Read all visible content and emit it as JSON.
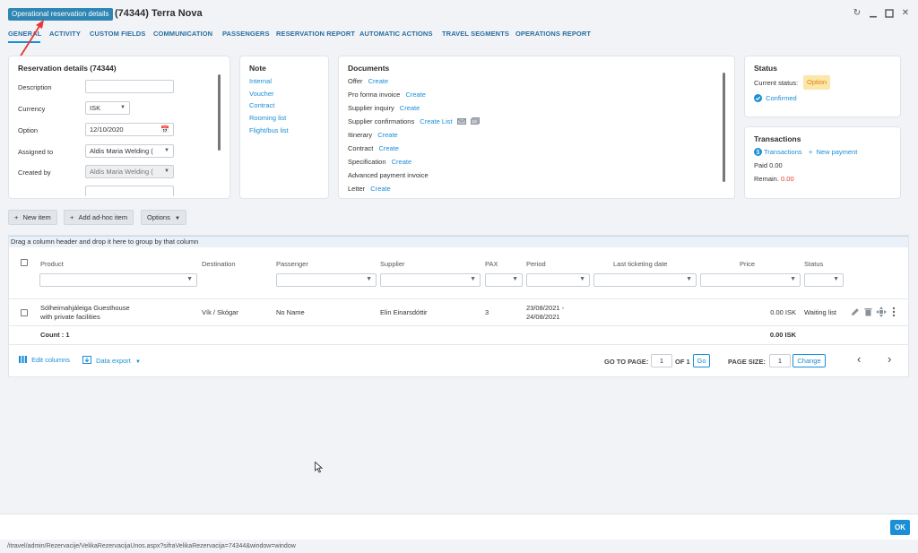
{
  "header": {
    "badge": "Operational reservation details",
    "title": "(74344) Terra Nova"
  },
  "tabs": [
    "GENERAL",
    "ACTIVITY",
    "CUSTOM FIELDS",
    "COMMUNICATION",
    "PASSENGERS",
    "RESERVATION REPORT",
    "AUTOMATIC ACTIONS",
    "TRAVEL SEGMENTS",
    "OPERATIONS REPORT"
  ],
  "reservation": {
    "heading": "Reservation details (74344)",
    "description_label": "Description",
    "description_value": "",
    "currency_label": "Currency",
    "currency_value": "ISK",
    "option_label": "Option",
    "option_value": "12/10/2020",
    "assigned_label": "Assigned to",
    "assigned_value": "Aldis Maria  Welding (",
    "created_label": "Created by",
    "created_value": "Aldis Maria  Welding ("
  },
  "note": {
    "heading": "Note",
    "items": [
      "Internal",
      "Voucher",
      "Contract",
      "Rooming list",
      "Flight/bus list"
    ]
  },
  "documents": {
    "heading": "Documents",
    "rows": [
      {
        "label": "Offer",
        "action": "Create"
      },
      {
        "label": "Pro forma invoice",
        "action": "Create"
      },
      {
        "label": "Supplier inquiry",
        "action": "Create"
      },
      {
        "label": "Supplier confirmations",
        "action": "Create List"
      },
      {
        "label": "Itinerary",
        "action": "Create"
      },
      {
        "label": "Contract",
        "action": "Create"
      },
      {
        "label": "Specification",
        "action": "Create"
      },
      {
        "label": "Advanced payment invoice",
        "action": ""
      },
      {
        "label": "Letter",
        "action": "Create"
      }
    ]
  },
  "status": {
    "heading": "Status",
    "current_label": "Current status:",
    "current_value": "Option",
    "confirmed_label": "Confirmed"
  },
  "transactions": {
    "heading": "Transactions",
    "link": "Transactions",
    "new_payment": "New payment",
    "paid_label": "Paid",
    "paid_value": "0.00",
    "remain_label": "Remain.",
    "remain_value": "0.00"
  },
  "toolbar": {
    "new_item": "New item",
    "add_adhoc": "Add ad-hoc item",
    "options": "Options"
  },
  "grid": {
    "drag_hint": "Drag a column header and drop it here to group by that column",
    "columns": [
      "Product",
      "Destination",
      "Passenger",
      "Supplier",
      "PAX",
      "Period",
      "Last ticketing date",
      "Price",
      "Status"
    ],
    "row": {
      "product_line1": "Sólheimahjáleiga Guesthouse",
      "product_line2": "with private facilities",
      "destination": "Vík / Skógar",
      "passenger": "No Name",
      "supplier": "Elin Einarsdóttir",
      "pax": "3",
      "period_line1": "23/08/2021 -",
      "period_line2": "24/08/2021",
      "last_ticketing": "",
      "price": "0.00 ISK",
      "status": "Waiting list"
    },
    "summary": {
      "count": "Count : 1",
      "price": "0.00 ISK"
    },
    "pager": {
      "edit_columns": "Edit columns",
      "data_export": "Data export",
      "go_to_page_label": "GO TO PAGE:",
      "page_value": "1",
      "of_label": "OF 1",
      "go_button": "Go",
      "page_size_label": "PAGE SIZE:",
      "page_size_value": "1",
      "change_button": "Change"
    }
  },
  "footer": {
    "ok": "OK",
    "status_url": "/itravel/admin/Rezervacije/VelikaRezervacijaUnos.aspx?sifraVelikaRezervacija=74344&window=window"
  },
  "colors": {
    "accent": "#1a8fd6",
    "badge_bg": "#2f86b3",
    "option_bg": "#fbe7a8",
    "option_text": "#e0821a",
    "remain_red": "#e03c31",
    "annotation_arrow": "#e53935"
  }
}
